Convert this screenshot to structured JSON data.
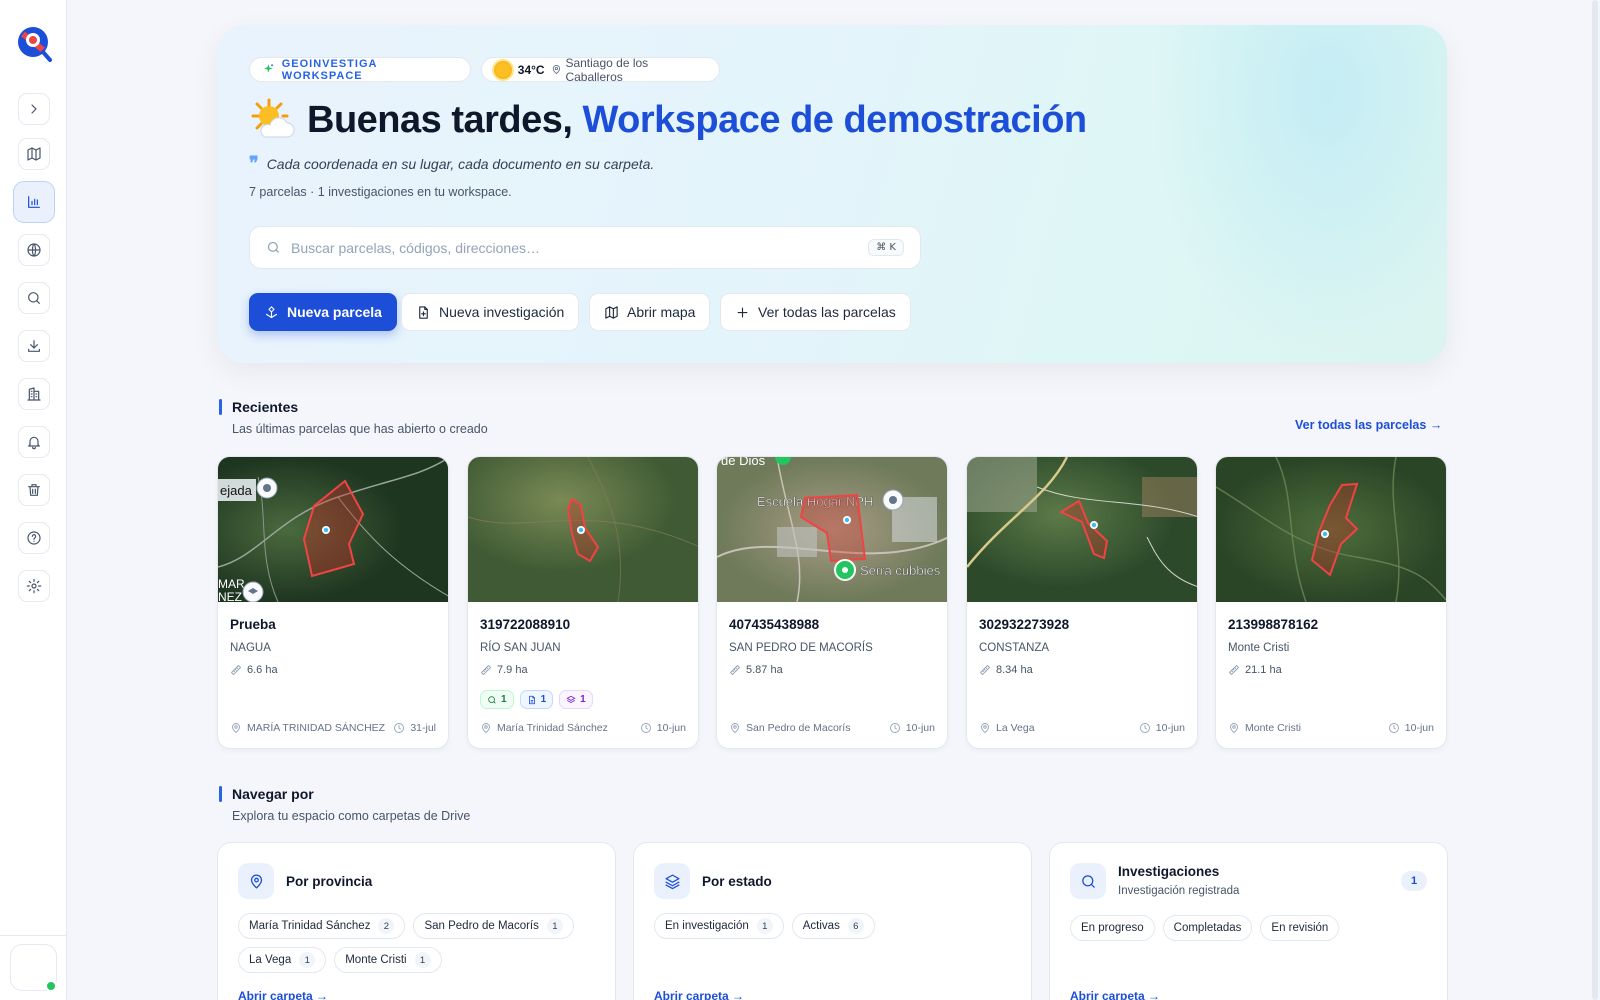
{
  "hero": {
    "workspace_badge": "GEOINVESTIGA WORKSPACE",
    "temperature": "34°C",
    "location": "Santiago de los Caballeros",
    "greeting": "Buenas tardes,",
    "workspace_name": "Workspace de demostración",
    "quote": "Cada coordenada en su lugar, cada documento en su carpeta.",
    "summary": "7 parcelas · 1 investigaciones en tu workspace.",
    "search_placeholder": "Buscar parcelas, códigos, direcciones…",
    "search_shortcut": "⌘ K",
    "actions": {
      "new_parcel": "Nueva parcela",
      "new_investigation": "Nueva investigación",
      "open_map": "Abrir mapa",
      "all_parcels": "Ver todas las parcelas"
    }
  },
  "recent": {
    "title": "Recientes",
    "subtitle": "Las últimas parcelas que has abierto o creado",
    "link": "Ver todas las parcelas",
    "cards": [
      {
        "title": "Prueba",
        "location": "NAGUA",
        "area": "6.6 ha",
        "province": "MARÍA TRINIDAD SÁNCHEZ",
        "date": "31-jul",
        "map_labels": [
          "ejada",
          "MAR",
          "NEZ"
        ]
      },
      {
        "title": "319722088910",
        "location": "RÍO SAN JUAN",
        "area": "7.9 ha",
        "province": "María Trinidad Sánchez",
        "date": "10-jun",
        "tags": [
          "1",
          "1",
          "1"
        ]
      },
      {
        "title": "407435438988",
        "location": "SAN PEDRO DE MACORÍS",
        "area": "5.87 ha",
        "province": "San Pedro de Macorís",
        "date": "10-jun",
        "map_labels": [
          "de Dios",
          "Escuela Hogar NPH",
          "Serra cubbies"
        ]
      },
      {
        "title": "302932273928",
        "location": "CONSTANZA",
        "area": "8.34 ha",
        "province": "La Vega",
        "date": "10-jun"
      },
      {
        "title": "213998878162",
        "location": "Monte Cristi",
        "area": "21.1 ha",
        "province": "Monte Cristi",
        "date": "10-jun"
      }
    ]
  },
  "browse": {
    "title": "Navegar por",
    "subtitle": "Explora tu espacio como carpetas de Drive",
    "open_folder": "Abrir carpeta",
    "by_province": {
      "title": "Por provincia",
      "chips": [
        {
          "label": "María Trinidad Sánchez",
          "count": "2"
        },
        {
          "label": "San Pedro de Macorís",
          "count": "1"
        },
        {
          "label": "La Vega",
          "count": "1"
        },
        {
          "label": "Monte Cristi",
          "count": "1"
        }
      ]
    },
    "by_status": {
      "title": "Por estado",
      "chips": [
        {
          "label": "En investigación",
          "count": "1"
        },
        {
          "label": "Activas",
          "count": "6"
        }
      ]
    },
    "investigations": {
      "title": "Investigaciones",
      "subtitle": "Investigación registrada",
      "count": "1",
      "chips": [
        "En progreso",
        "Completadas",
        "En revisión"
      ]
    }
  },
  "colors": {
    "accent": "#1d4ed8",
    "parcel_outline": "#dc2626",
    "online": "#22c55e"
  }
}
